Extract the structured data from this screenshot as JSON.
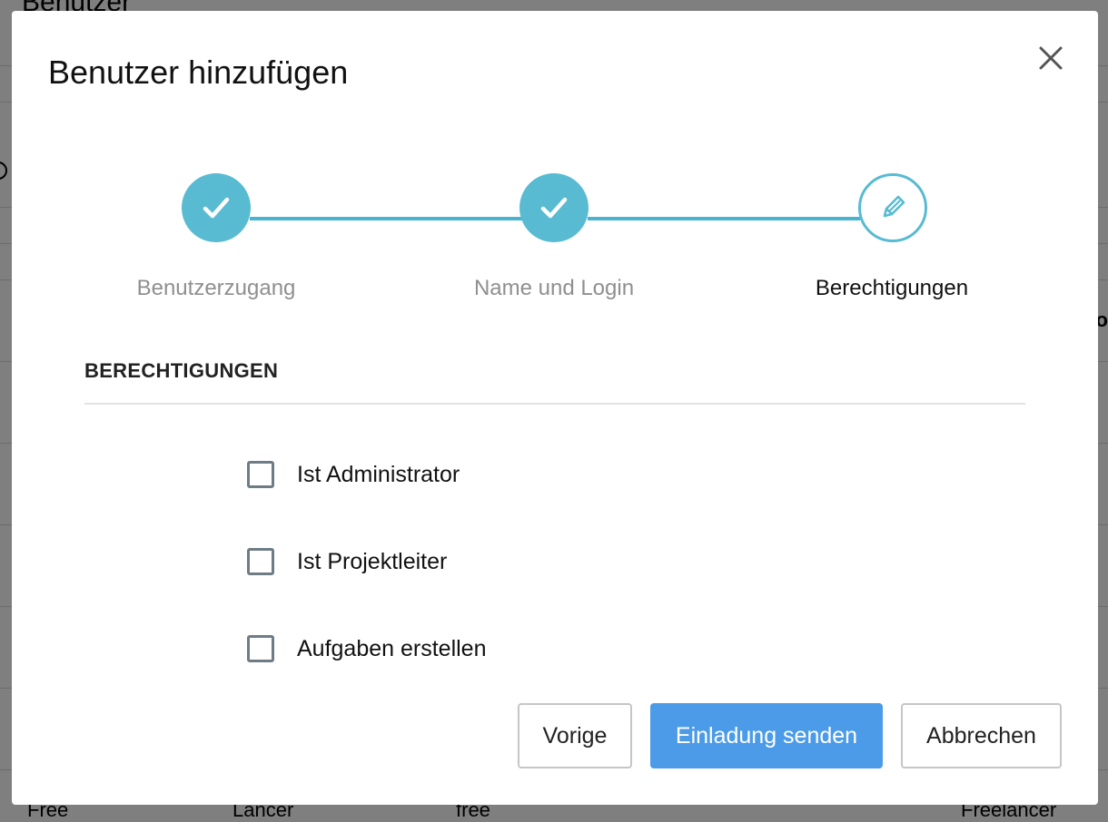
{
  "background": {
    "title": "Benutzer",
    "peek_text": "o",
    "row_cells": [
      "Free",
      "Lancer",
      "free",
      "Freelancer"
    ]
  },
  "modal": {
    "title": "Benutzer hinzufügen",
    "close_icon": "close-icon"
  },
  "stepper": {
    "steps": [
      {
        "label": "Benutzerzugang",
        "status": "completed",
        "icon": "check-icon"
      },
      {
        "label": "Name und Login",
        "status": "completed",
        "icon": "check-icon"
      },
      {
        "label": "Berechtigungen",
        "status": "current",
        "icon": "pencil-icon"
      }
    ],
    "accent_color": "#58bbd2"
  },
  "permissions": {
    "heading": "BERECHTIGUNGEN",
    "options": [
      {
        "label": "Ist Administrator",
        "checked": false
      },
      {
        "label": "Ist Projektleiter",
        "checked": false
      },
      {
        "label": "Aufgaben erstellen",
        "checked": false
      }
    ]
  },
  "footer": {
    "previous_label": "Vorige",
    "send_label": "Einladung senden",
    "cancel_label": "Abbrechen",
    "primary_color": "#4b9be8"
  }
}
